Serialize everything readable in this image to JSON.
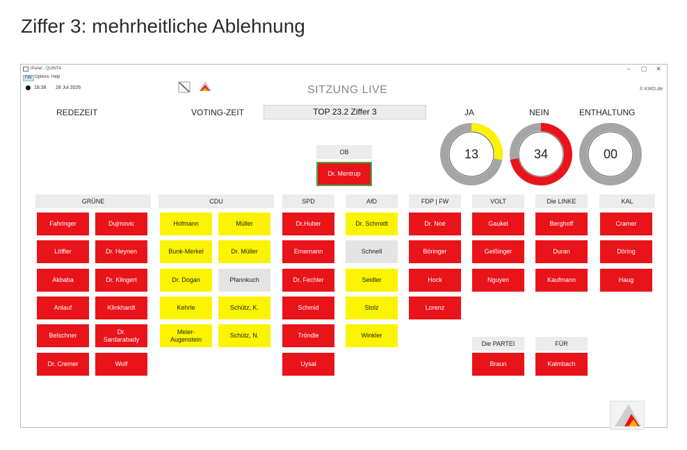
{
  "page_heading": "Ziffer 3: mehrheitliche Ablehnung",
  "window": {
    "title": "iPanel - QUINTA",
    "controls": [
      "–",
      "▢",
      "✕"
    ],
    "menu": [
      "File",
      "Options",
      "Help"
    ],
    "time": "18:38",
    "date": "28 Jul 2026",
    "live_title": "SITZUNG LIVE",
    "copyright": "© KWD.de"
  },
  "labels": {
    "redezeit": "REDEZEIT",
    "votingzeit": "VOTING-ZEIT",
    "top": "TOP 23.2 Ziffer 3"
  },
  "votes": {
    "ja": {
      "label": "JA",
      "value": "13",
      "fraction": 0.28
    },
    "nein": {
      "label": "NEIN",
      "value": "34",
      "fraction": 0.72
    },
    "enthaltung": {
      "label": "ENTHALTUNG",
      "value": "00",
      "fraction": 0
    }
  },
  "colors": {
    "red": "#e8141a",
    "yellow": "#fbf300",
    "grey": "#e4e4e4",
    "green": "#3ab04a"
  },
  "ob": {
    "label": "OB",
    "member": "Dr. Mentrup"
  },
  "groups": {
    "gruene": {
      "name": "GRÜNE",
      "members": [
        "Fahringer",
        "Dujmovic",
        "Löffler",
        "Dr. Heynen",
        "Akbaba",
        "Dr. Klingert",
        "Anlauf",
        "Klinkhardt",
        "Belschner",
        "Dr. Sardarabady",
        "Dr. Cremer",
        "Wolf"
      ]
    },
    "cdu": {
      "name": "CDU",
      "members": [
        "Hofmann",
        "Müller",
        "Bunk-Merkel",
        "Dr. Müller",
        "Dr. Dogan",
        "Pfannkuch",
        "Kehrle",
        "Schütz, K.",
        "Meier-Augenstein",
        "Schütz, N."
      ]
    },
    "spd": {
      "name": "SPD",
      "members": [
        "Dr.Huber",
        "Ernemann",
        "Dr. Fechler",
        "Schmid",
        "Tröndle",
        "Uysal"
      ]
    },
    "afd": {
      "name": "AfD",
      "members": [
        "Dr. Schmidt",
        "Schnell",
        "Seidler",
        "Stolz",
        "Winkler"
      ]
    },
    "fdp": {
      "name": "FDP | FW",
      "members": [
        "Dr. Noé",
        "Böringer",
        "Hock",
        "Lorenz"
      ]
    },
    "volt": {
      "name": "VOLT",
      "members": [
        "Gaukel",
        "Geißinger",
        "Nguyen"
      ]
    },
    "linke": {
      "name": "Die LINKE",
      "members": [
        "Berghoff",
        "Duran",
        "Kaufmann"
      ]
    },
    "kal": {
      "name": "KAL",
      "members": [
        "Cramer",
        "Döring",
        "Haug"
      ]
    },
    "partei": {
      "name": "Die PARTEI",
      "members": [
        "Braun"
      ]
    },
    "fuer": {
      "name": "FÜR",
      "members": [
        "Kalmbach"
      ]
    }
  },
  "icons": [
    "clock-icon",
    "karlsruhe-crest-icon",
    "karlsruhe-logo-icon",
    "kwd-logo-icon"
  ]
}
